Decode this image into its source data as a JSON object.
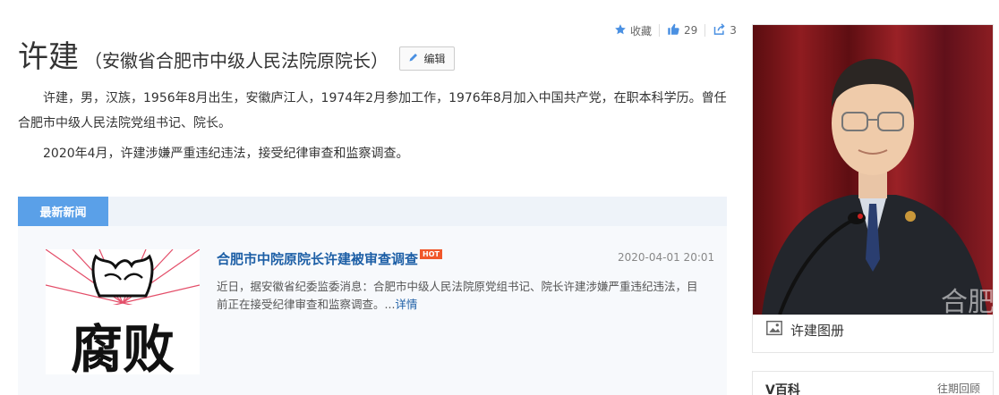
{
  "actions": {
    "favorite_label": "收藏",
    "like_count": "29",
    "share_count": "3"
  },
  "entry": {
    "name": "许建",
    "subtitle": "（安徽省合肥市中级人民法院原院长）",
    "edit_label": "编辑"
  },
  "summary": {
    "p1": "许建，男，汉族，1956年8月出生，安徽庐江人，1974年2月参加工作，1976年8月加入中国共产党，在职本科学历。曾任合肥市中级人民法院党组书记、院长。",
    "p2": "2020年4月，许建涉嫌严重违纪违法，接受纪律审查和监察调查。"
  },
  "news": {
    "tab_label": "最新新闻",
    "item": {
      "title": "合肥市中院原院长许建被审查调查",
      "badge": "HOT",
      "date": "2020-04-01 20:01",
      "summary": "近日，据安徽省纪委监委消息：合肥市中级人民法院原党组书记、院长许建涉嫌严重违纪违法，目前正在接受纪律审查和监察调查。...",
      "more_label": "详情",
      "thumb_text": "腐败"
    }
  },
  "sidebar": {
    "album_label": "许建图册",
    "box_title": "V百科",
    "box_link": "往期回顾",
    "watermark": "合肥"
  },
  "colors": {
    "accent": "#5aa0e8",
    "link": "#1d5fa6",
    "hot": "#f0572b"
  }
}
